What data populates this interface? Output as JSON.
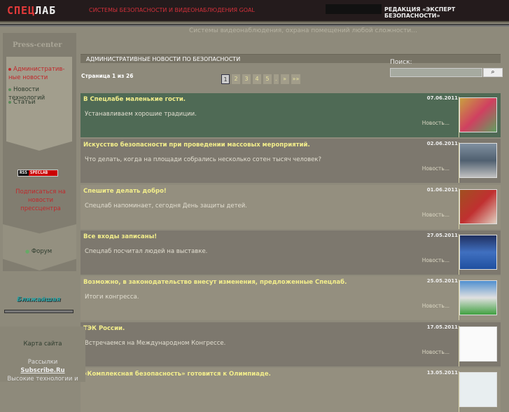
{
  "header": {
    "logo": "СПЕЦЛАБ",
    "logo_a": "СПЕЦ",
    "logo_b": "ЛАБ",
    "tagline": "СИСТЕМЫ БЕЗОПАСНОСТИ И ВИДЕОНАБЛЮДЕНИЯ GOAL",
    "right": "РЕДАКЦИЯ «ЭКСПЕРТ БЕЗОПАСНОСТИ»"
  },
  "subheader": "Системы видеонаблюдения, охрана помещений любой сложности...",
  "sidebar": {
    "title": "Press-center",
    "items": [
      {
        "label": "Административ- ные новости",
        "active": true
      },
      {
        "label": "Новости технологий"
      },
      {
        "label": "Статьи"
      }
    ],
    "rss": {
      "a": "RSS",
      "b": "SPECLAB"
    },
    "subscribe": "Подписаться на новости прессцентра",
    "forum": "Форум",
    "nearest": "Ближайшая",
    "footer": {
      "sitemap": "Карта сайта",
      "mailing": "Рассылки",
      "subscribe": "Subscribe.Ru",
      "hightech": "Высокие технологии и"
    }
  },
  "main": {
    "title": "АДМИНИСТРАТИВНЫЕ НОВОСТИ ПО БЕЗОПАСНОСТИ",
    "page_info": "Страница 1 из 26",
    "pager": [
      "1",
      "2",
      "3",
      "4",
      "5",
      ".",
      "»",
      "»»"
    ],
    "search": {
      "label": "Поиск:",
      "value": "",
      "button_icon": "search-icon"
    },
    "news": [
      {
        "title": "В Спецлабе маленькие гости.",
        "date": "07.06.2011",
        "summary": "Устанавливаем хорошие традиции.",
        "more": "Новость..."
      },
      {
        "title": "Искусство безопасности при проведении массовых мероприятий.",
        "date": "02.06.2011",
        "summary": "Что делать, когда на площади собрались несколько сотен тысяч человек?",
        "more": "Новость..."
      },
      {
        "title": "Спешите делать добро!",
        "date": "01.06.2011",
        "summary": "Спецлаб напоминает, сегодня День защиты детей.",
        "more": "Новость..."
      },
      {
        "title": "Все входы записаны!",
        "date": "27.05.2011",
        "summary": "Спецлаб посчитал людей на выставке.",
        "more": "Новость..."
      },
      {
        "title": "Возможно, в законодательство внесут изменения, предложенные Спецлаб.",
        "date": "25.05.2011",
        "summary": "Итоги конгресса.",
        "more": "Новость..."
      },
      {
        "title": "ТЭК России.",
        "date": "17.05.2011",
        "summary": "Встречаемся на Международном Конгрессе.",
        "more": "Новость..."
      },
      {
        "title": "«Комплексная безопасность» готовится к Олимпиаде.",
        "date": "13.05.2011",
        "summary": "",
        "more": ""
      }
    ]
  },
  "colors": {
    "row_active": "#4f6a55",
    "row_dark": "#7d786e",
    "row_light": "#948f7f",
    "title": "#f3ee8b",
    "accent_red": "#c0282b"
  }
}
